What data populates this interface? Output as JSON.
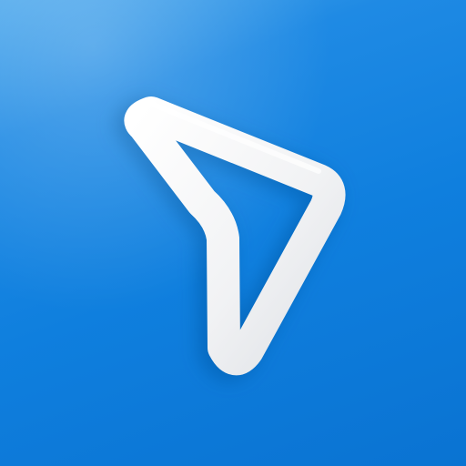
{
  "app_icon": {
    "background_color": "#0f7fde",
    "background_highlight_color": "#4da8ec",
    "glyph_color": "#f4f5f7",
    "glyph_shadow_color": "#0a5cab",
    "glyph_icon": "navigation-arrow-icon"
  }
}
